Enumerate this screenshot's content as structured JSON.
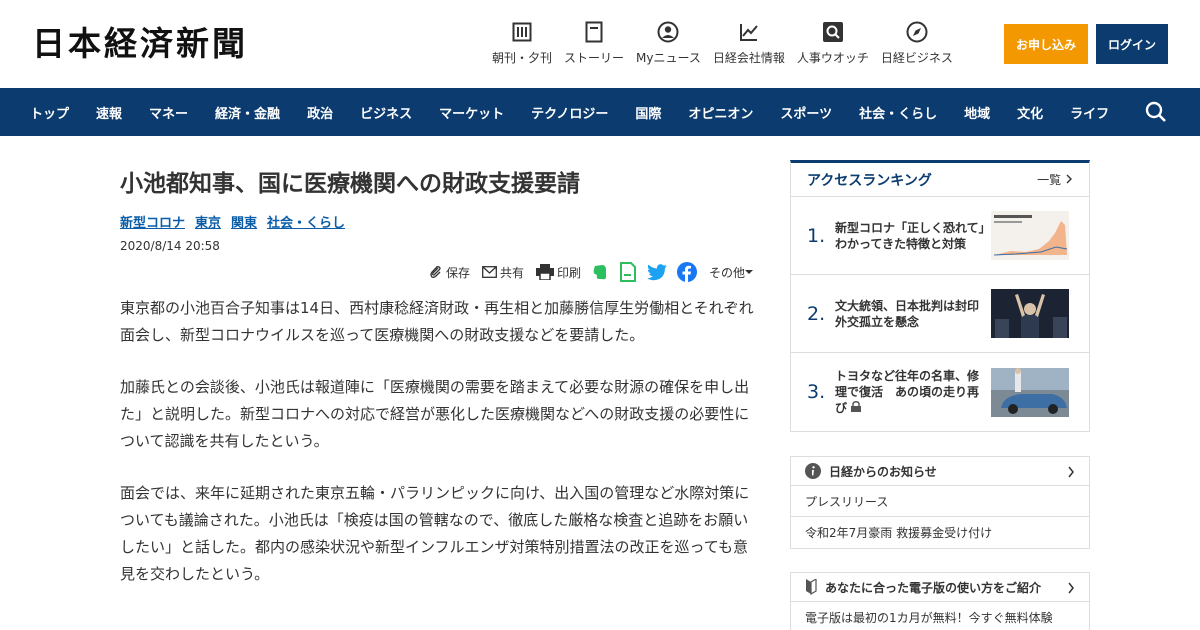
{
  "header": {
    "logo": "日本経済新聞",
    "util_nav": [
      {
        "label": "朝刊・夕刊",
        "icon": "newspaper-icon"
      },
      {
        "label": "ストーリー",
        "icon": "story-icon"
      },
      {
        "label": "Myニュース",
        "icon": "user-icon"
      },
      {
        "label": "日経会社情報",
        "icon": "chart-icon"
      },
      {
        "label": "人事ウオッチ",
        "icon": "search-icon"
      },
      {
        "label": "日経ビジネス",
        "icon": "compass-icon"
      }
    ],
    "apply_label": "お申し込み",
    "login_label": "ログイン"
  },
  "mainnav": [
    "トップ",
    "速報",
    "マネー",
    "経済・金融",
    "政治",
    "ビジネス",
    "マーケット",
    "テクノロジー",
    "国際",
    "オピニオン",
    "スポーツ",
    "社会・くらし",
    "地域",
    "文化",
    "ライフ"
  ],
  "article": {
    "title": "小池都知事、国に医療機関への財政支援要請",
    "tags": [
      "新型コロナ",
      "東京",
      "関東",
      "社会・くらし"
    ],
    "date": "2020/8/14 20:58",
    "share": {
      "save": "保存",
      "share": "共有",
      "print": "印刷",
      "more": "その他"
    },
    "paragraphs": [
      "東京都の小池百合子知事は14日、西村康稔経済財政・再生相と加藤勝信厚生労働相とそれぞれ面会し、新型コロナウイルスを巡って医療機関への財政支援などを要請した。",
      "加藤氏との会談後、小池氏は報道陣に「医療機関の需要を踏まえて必要な財源の確保を申し出た」と説明した。新型コロナへの対応で経営が悪化した医療機関などへの財政支援の必要性について認識を共有したという。",
      "面会では、来年に延期された東京五輪・パラリンピックに向け、出入国の管理など水際対策についても議論された。小池氏は「検疫は国の管轄なので、徹底した厳格な検査と追跡をお願いしたい」と話した。都内の感染状況や新型インフルエンザ対策特別措置法の改正を巡っても意見を交わしたという。"
    ]
  },
  "ranking": {
    "heading": "アクセスランキング",
    "more": "一覧",
    "items": [
      {
        "num": "1.",
        "title": "新型コロナ「正しく恐れて」　わかってきた特徴と対策"
      },
      {
        "num": "2.",
        "title": "文大統領、日本批判は封印　外交孤立を懸念"
      },
      {
        "num": "3.",
        "title": "トヨタなど往年の名車、修理で復活　あの頃の走り再び"
      }
    ]
  },
  "notice": {
    "heading": "日経からのお知らせ",
    "rows": [
      "プレスリリース",
      "令和2年7月豪雨 救援募金受け付け"
    ]
  },
  "guide": {
    "heading": "あなたに合った電子版の使い方をご紹介",
    "row": "電子版は最初の1カ月が無料！今すぐ無料体験"
  },
  "colors": {
    "navy": "#0b3b6f",
    "orange": "#f39800",
    "link": "#0b5da8"
  }
}
